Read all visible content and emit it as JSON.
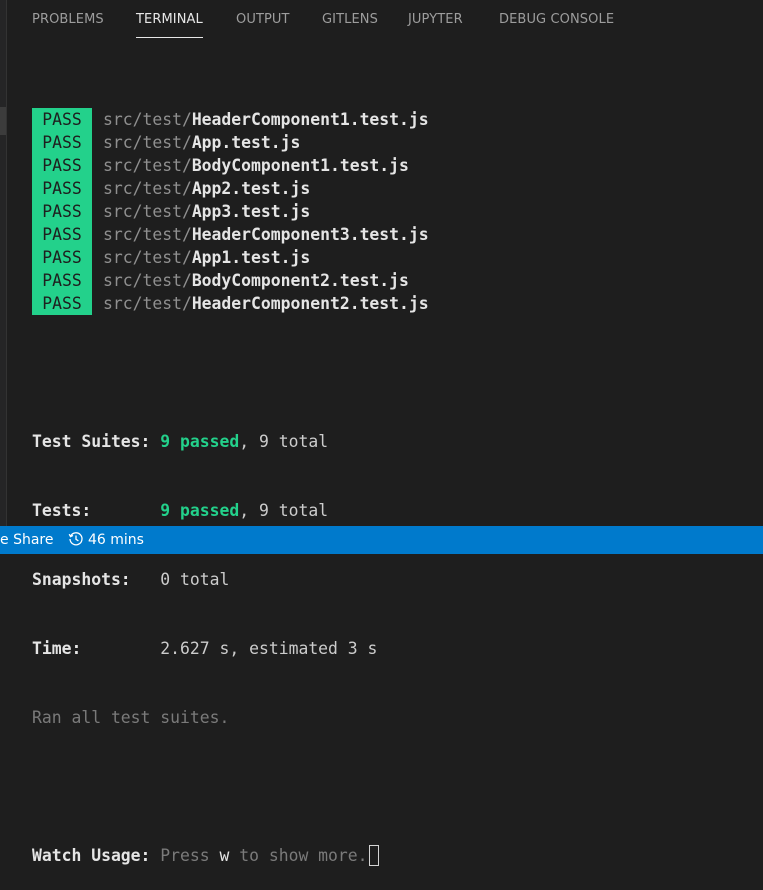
{
  "tabs": [
    {
      "label": "PROBLEMS",
      "active": false
    },
    {
      "label": "TERMINAL",
      "active": true
    },
    {
      "label": "OUTPUT",
      "active": false
    },
    {
      "label": "GITLENS",
      "active": false
    },
    {
      "label": "JUPYTER",
      "active": false
    },
    {
      "label": "DEBUG CONSOLE",
      "active": false
    }
  ],
  "terminal": {
    "results": [
      {
        "status": "PASS",
        "dir": "src/test/",
        "file": "HeaderComponent1.test.js"
      },
      {
        "status": "PASS",
        "dir": "src/test/",
        "file": "App.test.js"
      },
      {
        "status": "PASS",
        "dir": "src/test/",
        "file": "BodyComponent1.test.js"
      },
      {
        "status": "PASS",
        "dir": "src/test/",
        "file": "App2.test.js"
      },
      {
        "status": "PASS",
        "dir": "src/test/",
        "file": "App3.test.js"
      },
      {
        "status": "PASS",
        "dir": "src/test/",
        "file": "HeaderComponent3.test.js"
      },
      {
        "status": "PASS",
        "dir": "src/test/",
        "file": "App1.test.js"
      },
      {
        "status": "PASS",
        "dir": "src/test/",
        "file": "BodyComponent2.test.js"
      },
      {
        "status": "PASS",
        "dir": "src/test/",
        "file": "HeaderComponent2.test.js"
      }
    ],
    "summary": {
      "suites_label": "Test Suites:",
      "suites_passed": "9 passed",
      "suites_total": ", 9 total",
      "tests_label": "Tests:",
      "tests_passed": "9 passed",
      "tests_total": ", 9 total",
      "snapshots_label": "Snapshots:",
      "snapshots_value": "0 total",
      "time_label": "Time:",
      "time_value": "2.627 s, estimated 3 s",
      "ran_all": "Ran all test suites."
    },
    "watch": {
      "label": "Watch Usage:",
      "press": " Press ",
      "key": "w",
      "rest": " to show more."
    }
  },
  "statusbar": {
    "live_share": "e Share",
    "timer": "46 mins",
    "timer_icon": "history-icon",
    "background": "#007acc"
  },
  "colors": {
    "pass_badge": "#23d18b",
    "background": "#1e1e1e"
  }
}
